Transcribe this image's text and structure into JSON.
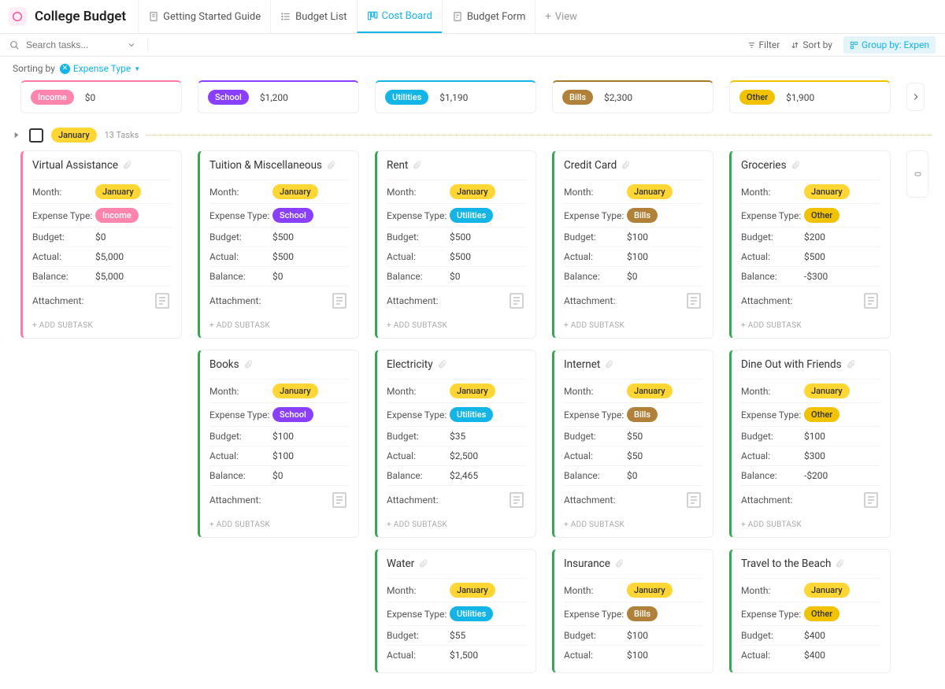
{
  "title": "College Budget",
  "tabs": [
    {
      "label": "Getting Started Guide"
    },
    {
      "label": "Budget List"
    },
    {
      "label": "Cost Board"
    },
    {
      "label": "Budget Form"
    }
  ],
  "add_view": "View",
  "search_placeholder": "Search tasks...",
  "toolbar": {
    "filter": "Filter",
    "sort": "Sort by",
    "group": "Group by: Expen"
  },
  "sorting_label": "Sorting by",
  "sorting_value": "Expense Type",
  "columns": [
    {
      "name": "Income",
      "amount": "$0",
      "cls": "income",
      "tagcls": "tag-income"
    },
    {
      "name": "School",
      "amount": "$1,200",
      "cls": "school",
      "tagcls": "tag-school"
    },
    {
      "name": "Utilities",
      "amount": "$1,190",
      "cls": "utilities",
      "tagcls": "tag-utilities"
    },
    {
      "name": "Bills",
      "amount": "$2,300",
      "cls": "bills",
      "tagcls": "tag-bills"
    },
    {
      "name": "Other",
      "amount": "$1,900",
      "cls": "other",
      "tagcls": "tag-other"
    }
  ],
  "group": {
    "month": "January",
    "count": "13 Tasks"
  },
  "labels": {
    "month": "Month:",
    "expense_type": "Expense Type:",
    "budget": "Budget:",
    "actual": "Actual:",
    "balance": "Balance:",
    "attachment": "Attachment:",
    "add_subtask": "+ ADD SUBTASK"
  },
  "vert_zero": "0",
  "cards": {
    "income": [
      {
        "title": "Virtual Assistance",
        "month": "January",
        "type": "Income",
        "type_tag": "tag-income",
        "budget": "$0",
        "actual": "$5,000",
        "balance": "$5,000"
      }
    ],
    "school": [
      {
        "title": "Tuition & Miscellaneous",
        "month": "January",
        "type": "School",
        "type_tag": "tag-school",
        "budget": "$500",
        "actual": "$500",
        "balance": "$0"
      },
      {
        "title": "Books",
        "month": "January",
        "type": "School",
        "type_tag": "tag-school",
        "budget": "$100",
        "actual": "$100",
        "balance": "$0"
      }
    ],
    "utilities": [
      {
        "title": "Rent",
        "month": "January",
        "type": "Utilities",
        "type_tag": "tag-utilities",
        "budget": "$500",
        "actual": "$500",
        "balance": "$0"
      },
      {
        "title": "Electricity",
        "month": "January",
        "type": "Utilities",
        "type_tag": "tag-utilities",
        "budget": "$35",
        "actual": "$2,500",
        "balance": "$2,465"
      },
      {
        "title": "Water",
        "month": "January",
        "type": "Utilities",
        "type_tag": "tag-utilities",
        "budget": "$55",
        "actual": "$1,500"
      }
    ],
    "bills": [
      {
        "title": "Credit Card",
        "month": "January",
        "type": "Bills",
        "type_tag": "tag-bills",
        "budget": "$100",
        "actual": "$100",
        "balance": "$0"
      },
      {
        "title": "Internet",
        "month": "January",
        "type": "Bills",
        "type_tag": "tag-bills",
        "budget": "$50",
        "actual": "$50",
        "balance": "$0"
      },
      {
        "title": "Insurance",
        "month": "January",
        "type": "Bills",
        "type_tag": "tag-bills",
        "budget": "$100",
        "actual": "$100"
      }
    ],
    "other": [
      {
        "title": "Groceries",
        "month": "January",
        "type": "Other",
        "type_tag": "tag-other",
        "budget": "$200",
        "actual": "$500",
        "balance": "-$300"
      },
      {
        "title": "Dine Out with Friends",
        "month": "January",
        "type": "Other",
        "type_tag": "tag-other",
        "budget": "$100",
        "actual": "$300",
        "balance": "-$200"
      },
      {
        "title": "Travel to the Beach",
        "month": "January",
        "type": "Other",
        "type_tag": "tag-other",
        "budget": "$400",
        "actual": "$400"
      }
    ]
  }
}
